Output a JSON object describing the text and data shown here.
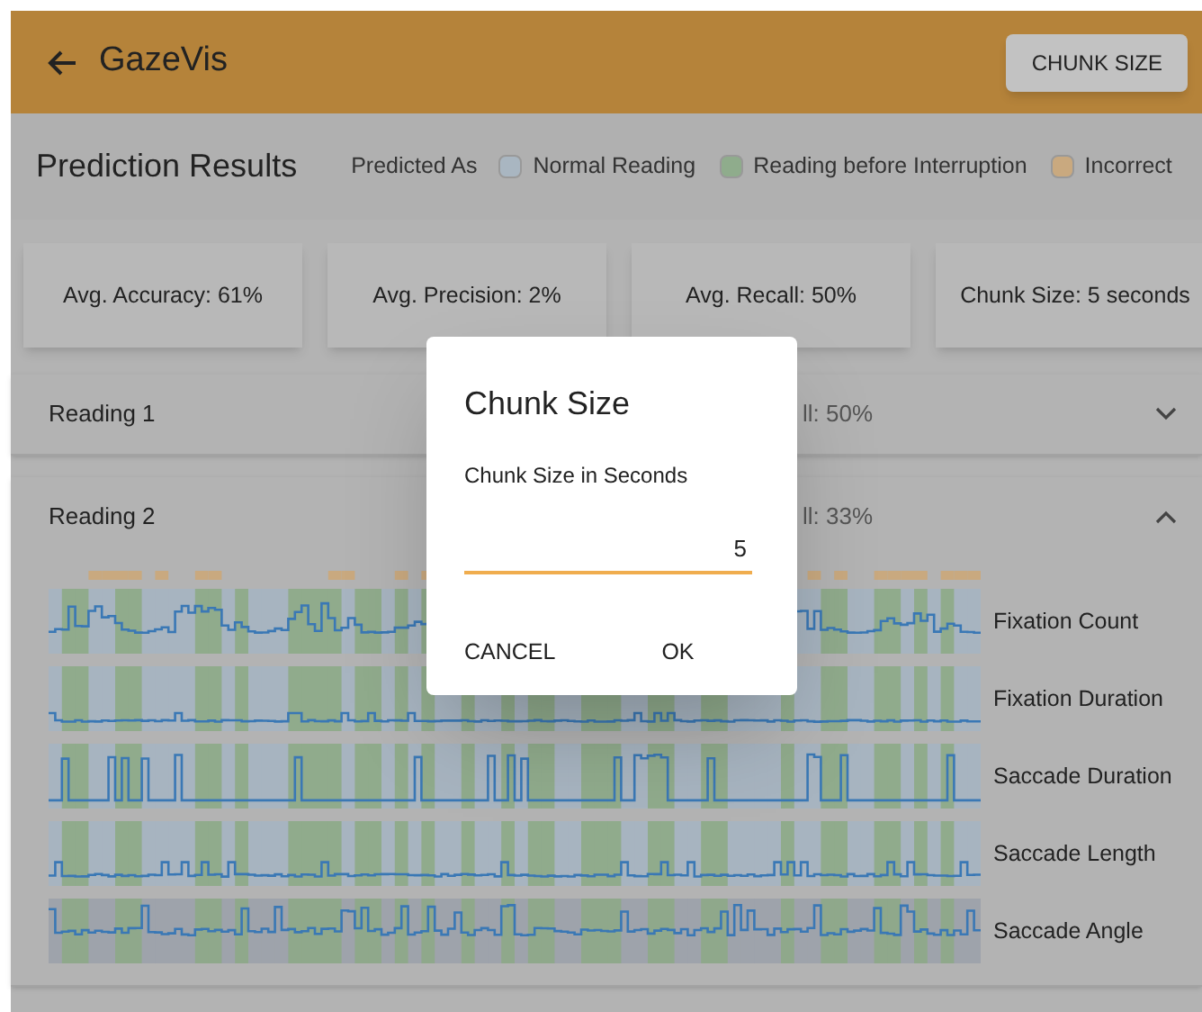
{
  "app_bar": {
    "title": "GazeVis",
    "action": "CHUNK SIZE"
  },
  "results": {
    "title": "Prediction Results",
    "legend_label": "Predicted As",
    "legend": [
      {
        "label": "Normal Reading",
        "color": "#a9b6c1"
      },
      {
        "label": "Reading before Interruption",
        "color": "#8fac8c"
      },
      {
        "label": "Incorrect",
        "color": "#c9a97f"
      }
    ]
  },
  "cards": [
    "Avg. Accuracy: 61%",
    "Avg. Precision: 2%",
    "Avg. Recall: 50%",
    "Chunk Size: 5 seconds"
  ],
  "readings": [
    {
      "label": "Reading 1",
      "summary": "ll: 50%",
      "expanded": false
    },
    {
      "label": "Reading 2",
      "summary": "ll: 33%",
      "expanded": true,
      "charts": [
        "Fixation Count",
        "Fixation Duration",
        "Saccade Duration",
        "Saccade Length",
        "Saccade Angle"
      ]
    }
  ],
  "dialog": {
    "title": "Chunk Size",
    "field_label": "Chunk Size in Seconds",
    "value": "5",
    "buttons": [
      "CANCEL",
      "OK"
    ]
  }
}
